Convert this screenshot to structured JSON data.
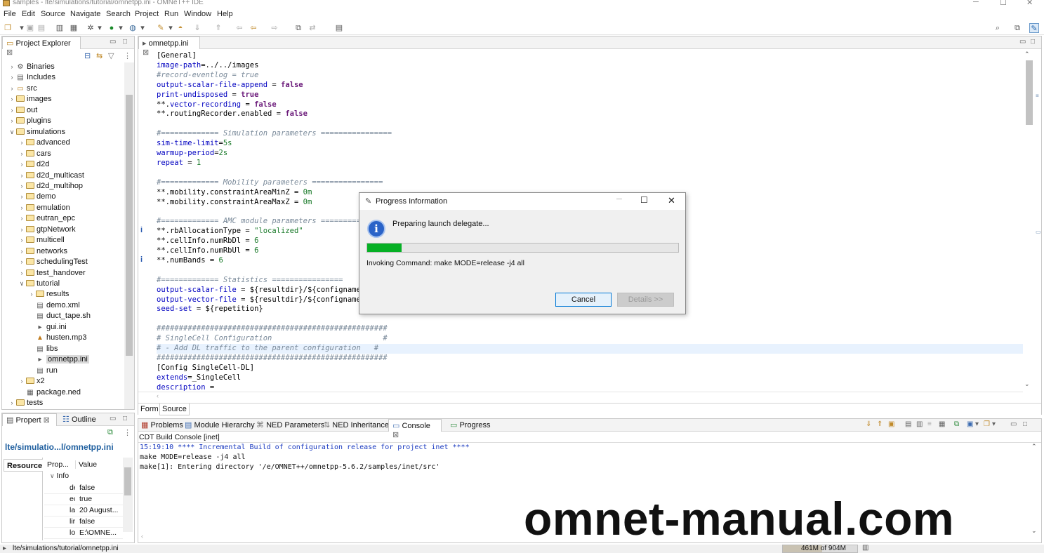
{
  "window": {
    "title": "samples - lte/simulations/tutorial/omnetpp.ini - OMNeT++ IDE"
  },
  "menu": [
    "File",
    "Edit",
    "Source",
    "Navigate",
    "Search",
    "Project",
    "Run",
    "Window",
    "Help"
  ],
  "project_explorer": {
    "tab": "Project Explorer",
    "items": [
      {
        "label": "Binaries",
        "depth": 1,
        "icon": "binaries-icon"
      },
      {
        "label": "Includes",
        "depth": 1,
        "icon": "includes-icon"
      },
      {
        "label": "src",
        "depth": 1,
        "icon": "src-folder-icon"
      },
      {
        "label": "images",
        "depth": 1,
        "icon": "folder-icon"
      },
      {
        "label": "out",
        "depth": 1,
        "icon": "folder-icon"
      },
      {
        "label": "plugins",
        "depth": 1,
        "icon": "folder-icon"
      },
      {
        "label": "simulations",
        "depth": 1,
        "icon": "folder-icon",
        "expanded": true
      },
      {
        "label": "advanced",
        "depth": 2,
        "icon": "folder-icon"
      },
      {
        "label": "cars",
        "depth": 2,
        "icon": "folder-icon"
      },
      {
        "label": "d2d",
        "depth": 2,
        "icon": "folder-icon"
      },
      {
        "label": "d2d_multicast",
        "depth": 2,
        "icon": "folder-icon"
      },
      {
        "label": "d2d_multihop",
        "depth": 2,
        "icon": "folder-icon"
      },
      {
        "label": "demo",
        "depth": 2,
        "icon": "folder-icon"
      },
      {
        "label": "emulation",
        "depth": 2,
        "icon": "folder-icon"
      },
      {
        "label": "eutran_epc",
        "depth": 2,
        "icon": "folder-icon"
      },
      {
        "label": "gtpNetwork",
        "depth": 2,
        "icon": "folder-icon"
      },
      {
        "label": "multicell",
        "depth": 2,
        "icon": "folder-icon"
      },
      {
        "label": "networks",
        "depth": 2,
        "icon": "folder-icon"
      },
      {
        "label": "schedulingTest",
        "depth": 2,
        "icon": "folder-icon"
      },
      {
        "label": "test_handover",
        "depth": 2,
        "icon": "folder-icon"
      },
      {
        "label": "tutorial",
        "depth": 2,
        "icon": "folder-icon",
        "expanded": true
      },
      {
        "label": "results",
        "depth": 3,
        "icon": "folder-icon"
      },
      {
        "label": "demo.xml",
        "depth": 3,
        "icon": "file-icon"
      },
      {
        "label": "duct_tape.sh",
        "depth": 3,
        "icon": "file-icon"
      },
      {
        "label": "gui.ini",
        "depth": 3,
        "icon": "ini-file-icon"
      },
      {
        "label": "husten.mp3",
        "depth": 3,
        "icon": "media-file-icon"
      },
      {
        "label": "libs",
        "depth": 3,
        "icon": "file-icon"
      },
      {
        "label": "omnetpp.ini",
        "depth": 3,
        "icon": "ini-file-icon",
        "selected": true
      },
      {
        "label": "run",
        "depth": 3,
        "icon": "file-icon"
      },
      {
        "label": "x2",
        "depth": 2,
        "icon": "folder-icon"
      },
      {
        "label": "package.ned",
        "depth": 2,
        "icon": "ned-file-icon"
      },
      {
        "label": "tests",
        "depth": 1,
        "icon": "folder-icon"
      }
    ]
  },
  "properties": {
    "tab": "Propert",
    "tab2": "Outline",
    "path": "lte/simulatio...l/omnetpp.ini",
    "resource_label": "Resource",
    "col_prop": "Prop...",
    "col_value": "Value",
    "group": "Info",
    "rows": [
      {
        "prop": "de",
        "value": "false"
      },
      {
        "prop": "ec",
        "value": "true"
      },
      {
        "prop": "la",
        "value": "20 August..."
      },
      {
        "prop": "lir",
        "value": "false"
      },
      {
        "prop": "lo",
        "value": "E:\\OMNE..."
      }
    ]
  },
  "editor": {
    "tab": "omnetpp.ini",
    "bottom_tabs": [
      "Form",
      "Source"
    ],
    "lines": [
      [
        [
          "",
          "[General]"
        ]
      ],
      [
        [
          "a",
          "image-path"
        ],
        [
          "",
          "=../../images"
        ]
      ],
      [
        [
          "c",
          "#record-eventlog = true"
        ]
      ],
      [
        [
          "a",
          "output-scalar-file-append"
        ],
        [
          "",
          " = "
        ],
        [
          "k",
          "false"
        ]
      ],
      [
        [
          "a",
          "print-undisposed"
        ],
        [
          "",
          " = "
        ],
        [
          "k",
          "true"
        ]
      ],
      [
        [
          "",
          "**."
        ],
        [
          "a",
          "vector-recording"
        ],
        [
          "",
          " = "
        ],
        [
          "k",
          "false"
        ]
      ],
      [
        [
          "",
          "**.routingRecorder.enabled = "
        ],
        [
          "k",
          "false"
        ]
      ],
      [
        [
          "",
          ""
        ]
      ],
      [
        [
          "c",
          "#============= Simulation parameters ================"
        ]
      ],
      [
        [
          "a",
          "sim-time-limit"
        ],
        [
          "",
          "="
        ],
        [
          "s",
          "5s"
        ]
      ],
      [
        [
          "a",
          "warmup-period"
        ],
        [
          "",
          "="
        ],
        [
          "s",
          "2s"
        ]
      ],
      [
        [
          "a",
          "repeat"
        ],
        [
          "",
          " = "
        ],
        [
          "s",
          "1"
        ]
      ],
      [
        [
          "",
          ""
        ]
      ],
      [
        [
          "c",
          "#============= Mobility parameters ================"
        ]
      ],
      [
        [
          "",
          "**.mobility.constraintAreaMinZ = "
        ],
        [
          "s",
          "0m"
        ]
      ],
      [
        [
          "",
          "**.mobility.constraintAreaMaxZ = "
        ],
        [
          "s",
          "0m"
        ]
      ],
      [
        [
          "",
          ""
        ]
      ],
      [
        [
          "c",
          "#============= AMC module parameters ==========="
        ]
      ],
      [
        [
          "",
          "**.rbAllocationType = "
        ],
        [
          "s",
          "\"localized\""
        ]
      ],
      [
        [
          "",
          "**.cellInfo.numRbDl = "
        ],
        [
          "s",
          "6"
        ]
      ],
      [
        [
          "",
          "**.cellInfo.numRbUl = "
        ],
        [
          "s",
          "6"
        ]
      ],
      [
        [
          "",
          "**.numBands = "
        ],
        [
          "s",
          "6"
        ]
      ],
      [
        [
          "",
          ""
        ]
      ],
      [
        [
          "c",
          "#============= Statistics ================"
        ]
      ],
      [
        [
          "a",
          "output-scalar-file"
        ],
        [
          "",
          " = ${resultdir}/${configname}"
        ]
      ],
      [
        [
          "a",
          "output-vector-file"
        ],
        [
          "",
          " = ${resultdir}/${configname}"
        ]
      ],
      [
        [
          "a",
          "seed-set"
        ],
        [
          "",
          " = ${repetition}"
        ]
      ],
      [
        [
          "",
          ""
        ]
      ],
      [
        [
          "c",
          "####################################################"
        ]
      ],
      [
        [
          "c",
          "# SingleCell Configuration                         #"
        ]
      ],
      [
        [
          "c",
          "# - Add DL traffic to the parent configuration   #"
        ]
      ],
      [
        [
          "c",
          "####################################################"
        ]
      ],
      [
        [
          "",
          "[Config SingleCell-DL]"
        ]
      ],
      [
        [
          "a",
          "extends"
        ],
        [
          "",
          "=_SingleCell"
        ]
      ],
      [
        [
          "a",
          "description"
        ],
        [
          "",
          " ="
        ]
      ]
    ]
  },
  "dialog": {
    "title": "Progress Information",
    "message": "Preparing launch delegate...",
    "progress": 0.11,
    "command": "Invoking Command: make MODE=release -j4 all",
    "cancel": "Cancel",
    "details": "Details >>",
    "accent": "#06b025"
  },
  "console": {
    "tabs": [
      "Problems",
      "Module Hierarchy",
      "NED Parameters",
      "NED Inheritance",
      "Console",
      "Progress"
    ],
    "header": "CDT Build Console [inet]",
    "lines": [
      {
        "text": "15:19:10 **** Incremental Build of configuration release for project inet ****",
        "color": "#1a3ac0"
      },
      {
        "text": "make MODE=release -j4 all",
        "color": "#111"
      },
      {
        "text": "make[1]: Entering directory '/e/OMNET++/omnetpp-5.6.2/samples/inet/src'",
        "color": "#111"
      }
    ]
  },
  "statusbar": {
    "path": "lte/simulations/tutorial/omnetpp.ini",
    "memory": "461M of 904M"
  },
  "watermark": "omnet-manual.com"
}
